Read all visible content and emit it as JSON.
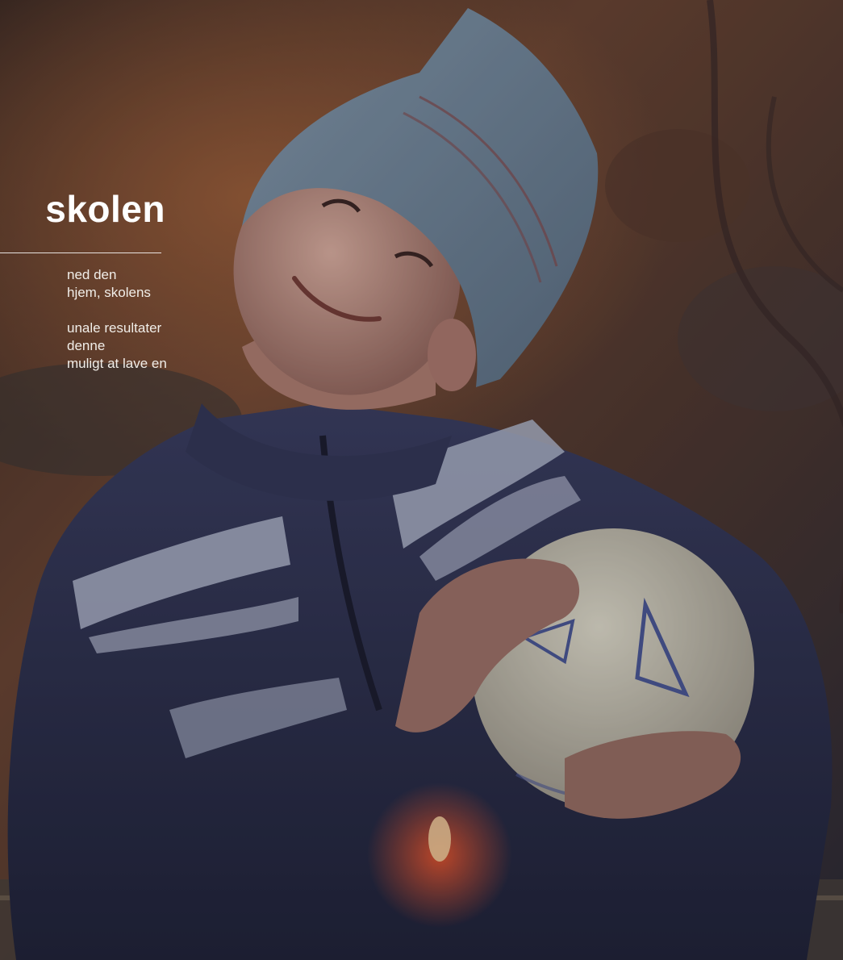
{
  "slide": {
    "heading": "skolen",
    "paragraphs": [
      "ned den\nhjem, skolens",
      "unale resultater\ndenne\nmuligt at lave en"
    ]
  },
  "photo": {
    "subject": "",
    "colors": {
      "background_warm": "#6b4a34",
      "hat": "#7c93a6",
      "jacket": "#2d3150",
      "ball": "#d8d3bf"
    }
  }
}
